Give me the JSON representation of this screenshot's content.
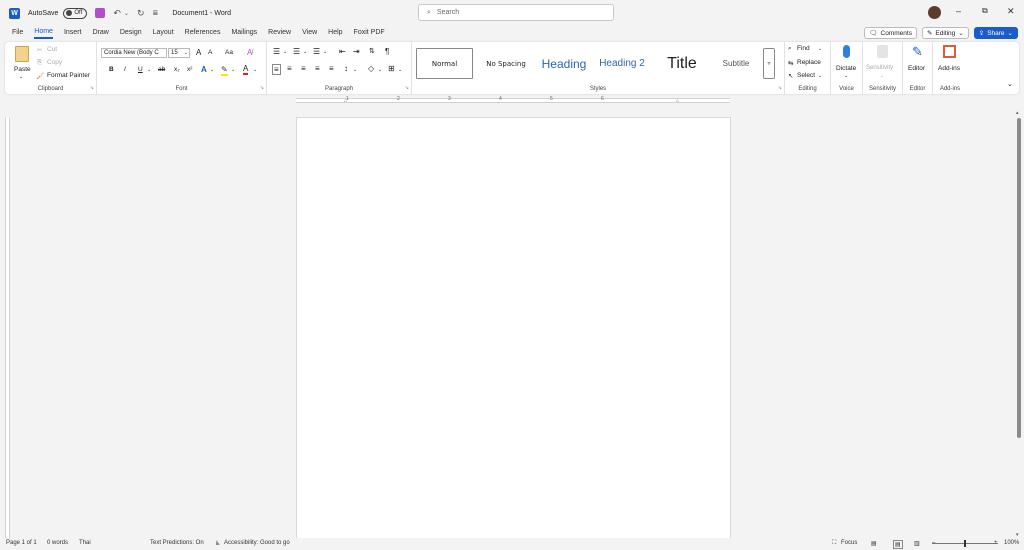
{
  "titlebar": {
    "autosave_label": "AutoSave",
    "autosave_state": "Off",
    "doc_title": "Document1 - Word",
    "search_placeholder": "Search"
  },
  "tabs": [
    "File",
    "Home",
    "Insert",
    "Draw",
    "Design",
    "Layout",
    "References",
    "Mailings",
    "Review",
    "View",
    "Help",
    "Foxit PDF"
  ],
  "active_tab": "Home",
  "right_buttons": {
    "comments": "Comments",
    "editing": "Editing",
    "share": "Share"
  },
  "ribbon": {
    "clipboard": {
      "label": "Clipboard",
      "paste": "Paste",
      "cut": "Cut",
      "copy": "Copy",
      "format_painter": "Format Painter"
    },
    "font": {
      "label": "Font",
      "font_name": "Cordia New (Body C",
      "font_size": "15",
      "grow": "A",
      "shrink": "A",
      "case": "Aa",
      "bold": "B",
      "italic": "I",
      "underline": "U",
      "strike": "ab",
      "sub": "x₂",
      "sup": "x²"
    },
    "paragraph": {
      "label": "Paragraph",
      "pilcrow": "¶"
    },
    "styles": {
      "label": "Styles",
      "items": [
        "Normal",
        "No Spacing",
        "Heading",
        "Heading 2",
        "Title",
        "Subtitle"
      ]
    },
    "editing": {
      "label": "Editing",
      "find": "Find",
      "replace": "Replace",
      "select": "Select"
    },
    "voice": {
      "label": "Voice",
      "dictate": "Dictate"
    },
    "sensitivity": {
      "label": "Sensitivity",
      "button": "Sensitivity"
    },
    "editor": {
      "label": "Editor",
      "button": "Editor"
    },
    "addins": {
      "label": "Add-ins",
      "button": "Add-ins"
    }
  },
  "ruler": {
    "numbers": [
      "1",
      "2",
      "3",
      "4",
      "5",
      "6"
    ]
  },
  "statusbar": {
    "page": "Page 1 of 1",
    "words": "0 words",
    "language": "Thai",
    "text_predictions": "Text Predictions: On",
    "accessibility": "Accessibility: Good to go",
    "focus": "Focus",
    "zoom": "100%"
  },
  "colors": {
    "accent": "#1a5cc8",
    "highlight": "#ffe600",
    "font_color": "#e02020"
  }
}
